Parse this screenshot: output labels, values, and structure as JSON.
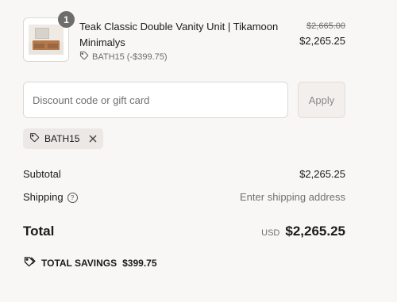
{
  "line_item": {
    "quantity": "1",
    "title": "Teak Classic Double Vanity Unit | Tikamoon Minimalys",
    "discount": "BATH15 (-$399.75)",
    "original_price": "$2,665.00",
    "current_price": "$2,265.25"
  },
  "discount_form": {
    "placeholder": "Discount code or gift card",
    "apply_label": "Apply"
  },
  "applied_code": "BATH15",
  "summary": {
    "subtotal_label": "Subtotal",
    "subtotal_value": "$2,265.25",
    "shipping_label": "Shipping",
    "shipping_value": "Enter shipping address",
    "total_label": "Total",
    "total_currency": "USD",
    "total_value": "$2,265.25",
    "savings_label": "TOTAL SAVINGS",
    "savings_value": "$399.75"
  },
  "icons": [
    "tag-icon",
    "close-icon",
    "info-icon",
    "tags-icon"
  ]
}
